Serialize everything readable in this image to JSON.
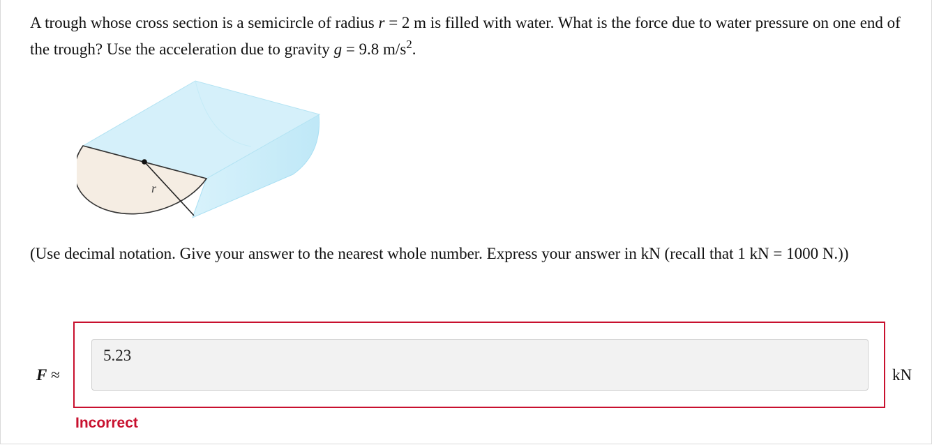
{
  "question": {
    "text_1": "A trough whose cross section is a semicircle of radius ",
    "r_var": "r",
    "eq_1": " = 2 m is filled with water. What is the force due to water pressure on one end of the trough? Use the acceleration due to gravity ",
    "g_var": "g",
    "eq_2": " = 9.8 m/s",
    "exponent": "2",
    "end": "."
  },
  "figure": {
    "radius_label": "r"
  },
  "instruction": "(Use decimal notation. Give your answer to the nearest whole number. Express your answer in kN (recall that 1 kN = 1000 N.))",
  "answer": {
    "var": "F",
    "approx": " ≈",
    "value": "5.23",
    "unit": "kN",
    "status": "incorrect",
    "feedback": "Incorrect"
  },
  "colors": {
    "error": "#c8102e",
    "water": "#d5f0fa",
    "cross_section": "#f5ede3"
  }
}
